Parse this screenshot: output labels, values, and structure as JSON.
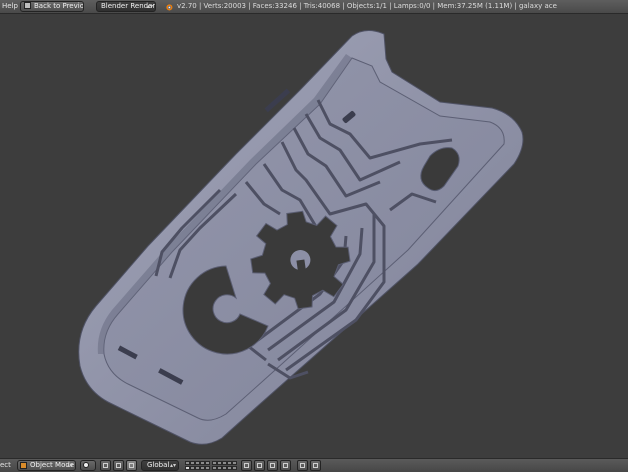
{
  "top_header": {
    "menu_help": "Help",
    "back_button_label": "Back to Previous",
    "render_engine": "Blender Render",
    "stats": "v2.70 | Verts:20003 | Faces:33246 | Tris:40068 | Objects:1/1 | Lamps:0/0 | Mem:37.25M (1.11M) | galaxy ace"
  },
  "bottom_header": {
    "menu_object": "ect",
    "mode": "Object Mode",
    "orientation": "Global"
  },
  "colors": {
    "viewport_bg": "#3d3d3d",
    "model_top": "#8c8fa6",
    "model_shade": "#5d6075",
    "mode_accent": "#d88b2a"
  },
  "icons": [
    "blender-logo-icon",
    "fullscreen-icon",
    "object-mode-cube-icon",
    "viewport-shading-icon",
    "pivot-icon",
    "manipulator-icon",
    "layer-grid-icon",
    "lock-icon",
    "render-icon"
  ]
}
